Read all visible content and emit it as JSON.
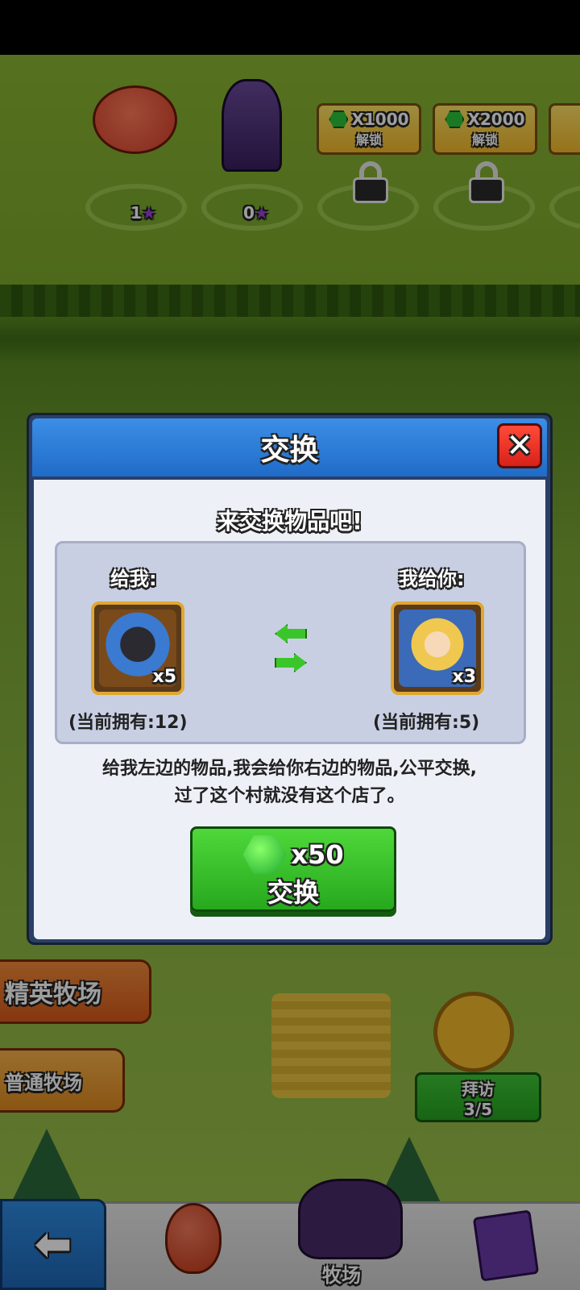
{
  "farm": {
    "slots": [
      {
        "stars": "1"
      },
      {
        "stars": "0"
      }
    ],
    "unlock_buttons": [
      {
        "cost": "X1000",
        "label": "解锁"
      },
      {
        "cost": "X2000",
        "label": "解锁"
      }
    ],
    "elite_ranch_label": "精英牧场",
    "normal_ranch_label": "普通牧场",
    "visit_label": "拜访",
    "visit_count": "3/5"
  },
  "nav": {
    "ranch_label": "牧场"
  },
  "dialog": {
    "title": "交换",
    "subtitle": "来交换物品吧!",
    "give_label": "给我:",
    "get_label": "我给你:",
    "give_item": {
      "qty": "x5",
      "owned": "(当前拥有:12)"
    },
    "get_item": {
      "qty": "x3",
      "owned": "(当前拥有:5)"
    },
    "description_line1": "给我左边的物品,我会给你右边的物品,公平交换,",
    "description_line2": "过了这个村就没有这个店了。",
    "trade_button": {
      "cost": "x50",
      "label": "交换"
    }
  },
  "colors": {
    "header_blue": "#2a7ad8",
    "close_red": "#e8301f",
    "trade_green": "#3cc62e",
    "panel_bg": "#eef0f8"
  }
}
